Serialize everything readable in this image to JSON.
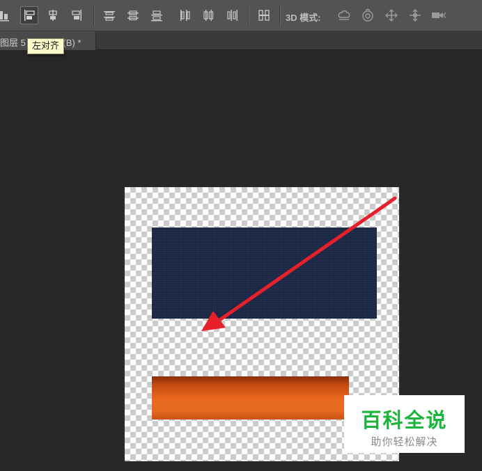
{
  "toolbar": {
    "align_buttons": [
      {
        "name": "align-bottom-edges"
      },
      {
        "name": "align-left-edges",
        "active": true
      },
      {
        "name": "align-horizontal-centers"
      },
      {
        "name": "align-right-edges"
      }
    ],
    "distribute_vertical": [
      {
        "name": "distribute-top-edges"
      },
      {
        "name": "distribute-vertical-centers"
      },
      {
        "name": "distribute-bottom-edges"
      }
    ],
    "distribute_horizontal": [
      {
        "name": "distribute-left-edges"
      },
      {
        "name": "distribute-horizontal-centers"
      },
      {
        "name": "distribute-right-edges"
      }
    ],
    "auto_align": {
      "name": "auto-align-layers"
    },
    "mode_3d_label": "3D 模式:",
    "mode_3d_tools": [
      "rotate-3d-icon",
      "roll-3d-icon",
      "pan-3d-icon",
      "slide-3d-icon",
      "scale-3d-icon"
    ]
  },
  "document_tab": {
    "title": "图层 5",
    "title_suffix": "(B) *"
  },
  "tooltip": {
    "text": "左对齐"
  },
  "canvas": {
    "layers": [
      {
        "name": "navy-rectangle",
        "color": "#1a2744"
      },
      {
        "name": "orange-gradient-bar",
        "color": "#e8681f"
      }
    ],
    "annotation_arrow_color": "#e8202a"
  },
  "watermark": {
    "title": "百科全说",
    "subtitle": "助你轻松解决"
  },
  "colors": {
    "toolbar_bg": "#535353",
    "workspace_bg": "#282828",
    "tooltip_bg": "#ffffcc",
    "watermark_green": "#1cb53b"
  }
}
